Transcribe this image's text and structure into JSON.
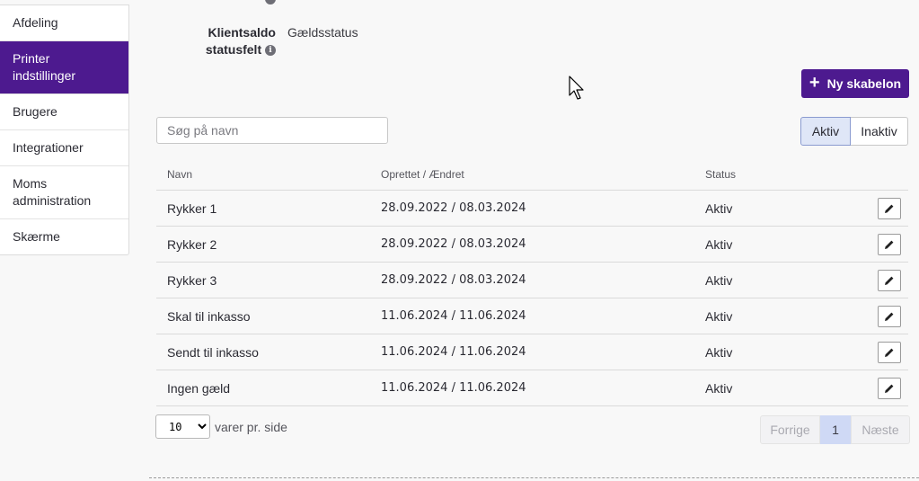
{
  "sidebar": {
    "items": [
      {
        "label": "Afdeling",
        "active": false
      },
      {
        "label": "Printer indstillinger",
        "active": true
      },
      {
        "label": "Brugere",
        "active": false
      },
      {
        "label": "Integrationer",
        "active": false
      },
      {
        "label": "Moms administration",
        "active": false
      },
      {
        "label": "Skærme",
        "active": false
      }
    ]
  },
  "field": {
    "label_line1": "Klientsaldo",
    "label_line2": "statusfelt",
    "info_icon": "info-icon",
    "value": "Gældsstatus"
  },
  "toolbar": {
    "new_button_label": "Ny skabelon",
    "new_button_icon": "plus-icon"
  },
  "search": {
    "placeholder": "Søg på navn",
    "value": ""
  },
  "filter": {
    "active_label": "Aktiv",
    "inactive_label": "Inaktiv",
    "selected": "Aktiv"
  },
  "table": {
    "headers": {
      "name": "Navn",
      "dates": "Oprettet / Ændret",
      "status": "Status"
    },
    "rows": [
      {
        "name": "Rykker 1",
        "dates": "28.09.2022 / 08.03.2024",
        "status": "Aktiv"
      },
      {
        "name": "Rykker 2",
        "dates": "28.09.2022 / 08.03.2024",
        "status": "Aktiv"
      },
      {
        "name": "Rykker 3",
        "dates": "28.09.2022 / 08.03.2024",
        "status": "Aktiv"
      },
      {
        "name": "Skal til inkasso",
        "dates": "11.06.2024 / 11.06.2024",
        "status": "Aktiv"
      },
      {
        "name": "Sendt til inkasso",
        "dates": "11.06.2024 / 11.06.2024",
        "status": "Aktiv"
      },
      {
        "name": "Ingen gæld",
        "dates": "11.06.2024 / 11.06.2024",
        "status": "Aktiv"
      }
    ]
  },
  "pagination": {
    "per_page_value": "10",
    "per_page_label": "varer pr. side",
    "prev_label": "Forrige",
    "current_page": "1",
    "next_label": "Næste"
  },
  "colors": {
    "brand": "#4d1a8f",
    "toggle_active_bg": "#dfe6f7",
    "pager_current_bg": "#cfd9f5"
  }
}
